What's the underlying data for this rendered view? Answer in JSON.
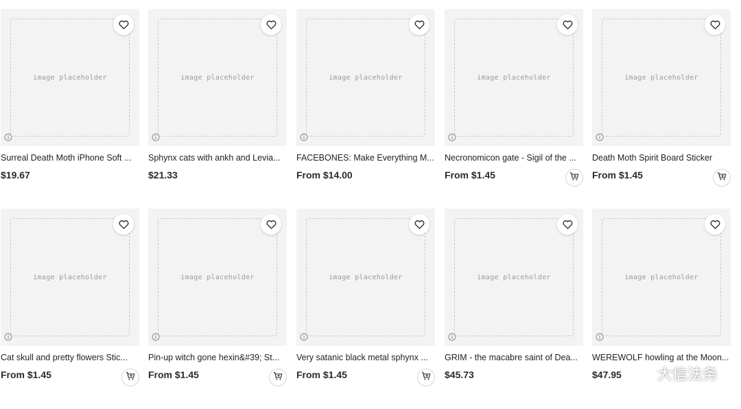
{
  "products": [
    {
      "title": "Surreal Death Moth iPhone Soft ...",
      "price": "$19.67",
      "has_cart": false
    },
    {
      "title": "Sphynx cats with ankh and Levia...",
      "price": "$21.33",
      "has_cart": false
    },
    {
      "title": "FACEBONES: Make Everything M...",
      "price": "From $14.00",
      "has_cart": false
    },
    {
      "title": "Necronomicon gate - Sigil of the ...",
      "price": "From $1.45",
      "has_cart": true
    },
    {
      "title": "Death Moth Spirit Board Sticker",
      "price": "From $1.45",
      "has_cart": true
    },
    {
      "title": "Cat skull and pretty flowers Stic...",
      "price": "From $1.45",
      "has_cart": true
    },
    {
      "title": "Pin-up witch gone hexin&#39; St...",
      "price": "From $1.45",
      "has_cart": true
    },
    {
      "title": "Very satanic black metal sphynx ...",
      "price": "From $1.45",
      "has_cart": true
    },
    {
      "title": "GRIM - the macabre saint of Dea...",
      "price": "$45.73",
      "has_cart": false
    },
    {
      "title": "WEREWOLF howling at the Moon...",
      "price": "$47.95",
      "has_cart": false
    }
  ],
  "icons": {
    "favorite": "heart-icon",
    "info": "info-icon",
    "cart": "add-to-cart-icon"
  },
  "colors": {
    "card_bg": "#f3f3f3",
    "text": "#222222",
    "price": "#2a2a2a"
  },
  "watermark": {
    "text": "大信法务"
  }
}
